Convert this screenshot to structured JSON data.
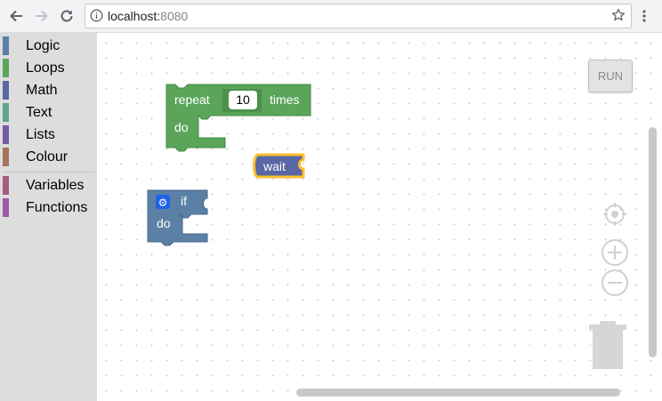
{
  "browser": {
    "url_host": "localhost:",
    "url_port": "8080"
  },
  "toolbox": {
    "categories": [
      {
        "label": "Logic",
        "color": "#5b80a5"
      },
      {
        "label": "Loops",
        "color": "#5ba55b"
      },
      {
        "label": "Math",
        "color": "#5b67a5"
      },
      {
        "label": "Text",
        "color": "#5ba58c"
      },
      {
        "label": "Lists",
        "color": "#745ba5"
      },
      {
        "label": "Colour",
        "color": "#a5745b"
      },
      {
        "label": "Variables",
        "color": "#a55b80"
      },
      {
        "label": "Functions",
        "color": "#995ba5"
      }
    ]
  },
  "workspace": {
    "run_label": "RUN",
    "repeat_block": {
      "label": "repeat",
      "count": "10",
      "times_label": "times",
      "do_label": "do",
      "color": "#5ba55b"
    },
    "wait_block": {
      "label": "wait",
      "color": "#5b67a5",
      "highlight": "#fbc02d"
    },
    "if_block": {
      "label": "if",
      "do_label": "do",
      "color": "#5b80a5",
      "gear_color": "#1e63e8"
    }
  }
}
